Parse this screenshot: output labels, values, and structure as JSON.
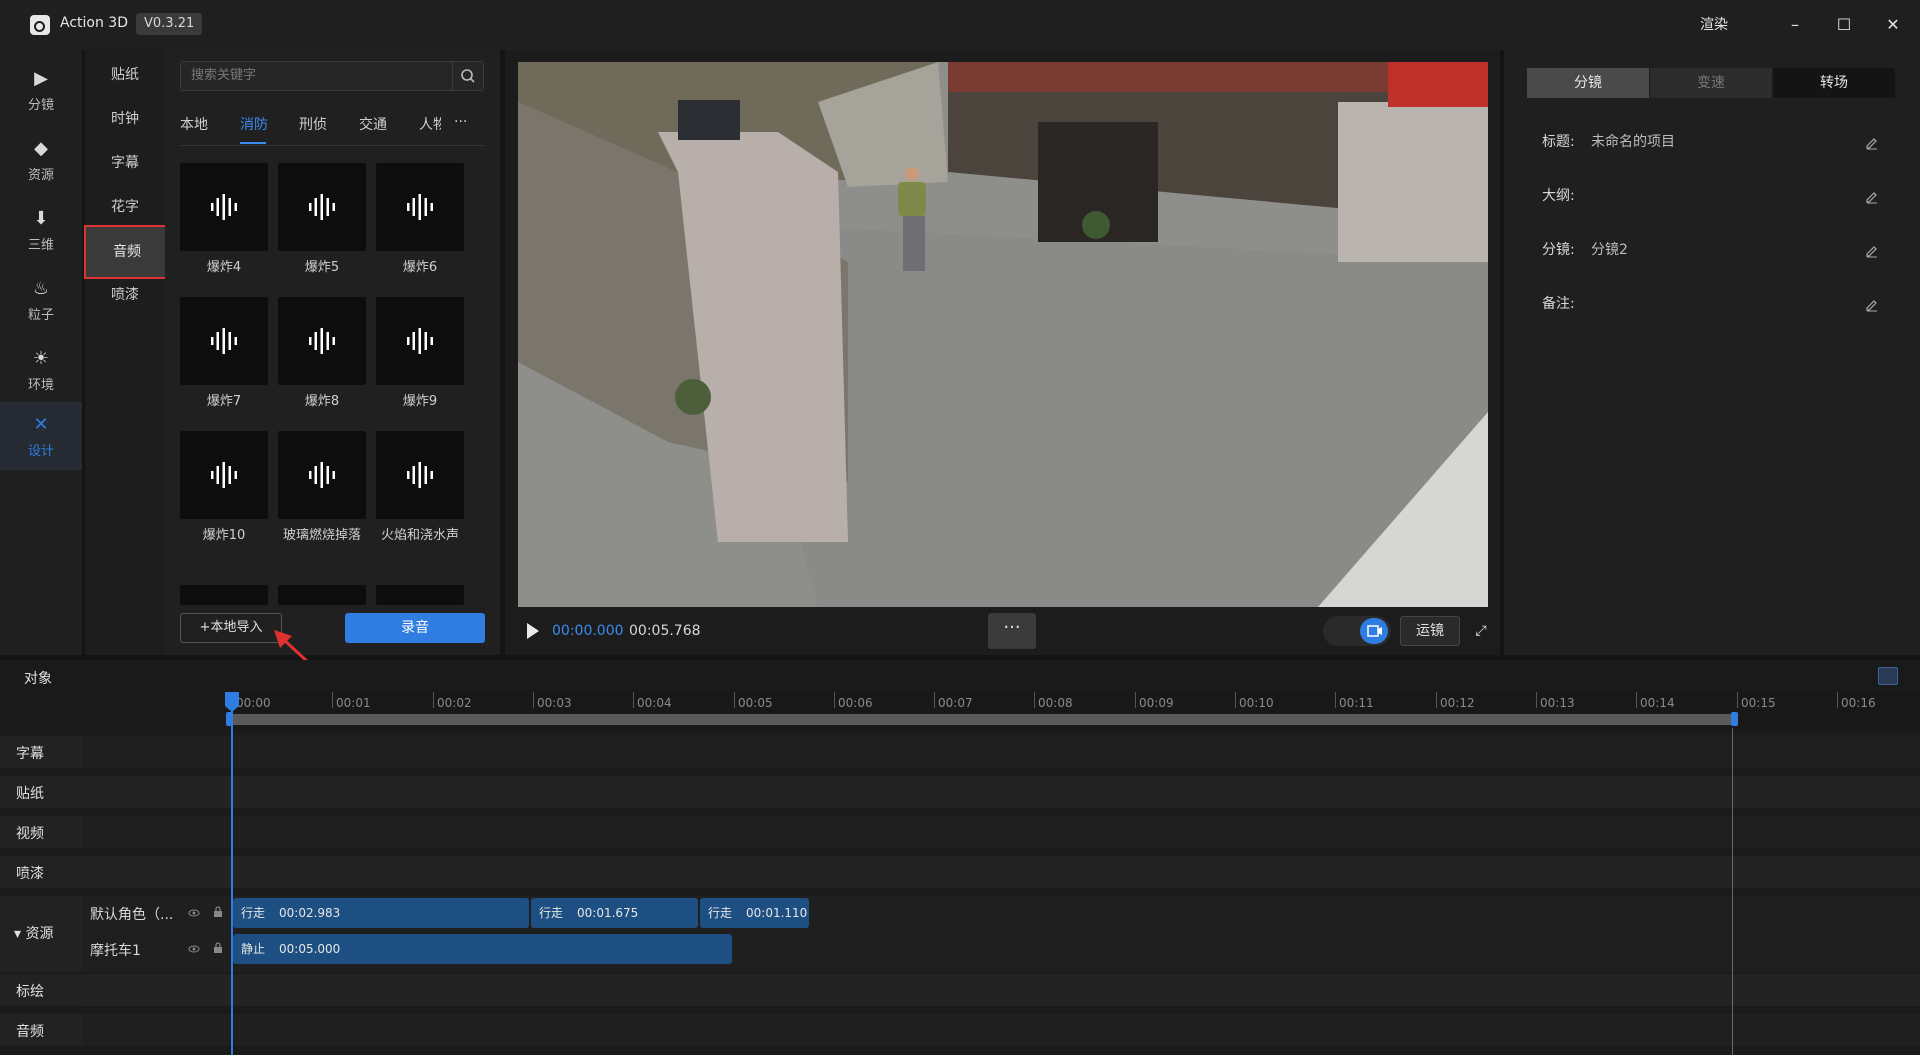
{
  "titlebar": {
    "app_name": "Action 3D",
    "version": "V0.3.21",
    "render_label": "渲染",
    "minimize": "–",
    "maximize": "☐",
    "close": "✕"
  },
  "rail": [
    {
      "label": "分镜",
      "icon": "film-icon"
    },
    {
      "label": "资源",
      "icon": "cube-icon"
    },
    {
      "label": "三维",
      "icon": "download-box-icon"
    },
    {
      "label": "粒子",
      "icon": "flame-icon"
    },
    {
      "label": "环境",
      "icon": "sun-icon"
    },
    {
      "label": "设计",
      "icon": "tools-icon",
      "active": true
    }
  ],
  "subcategories": [
    {
      "label": "贴纸"
    },
    {
      "label": "时钟"
    },
    {
      "label": "字幕"
    },
    {
      "label": "花字"
    },
    {
      "label": "音频",
      "active": true
    },
    {
      "label": "喷漆"
    }
  ],
  "search": {
    "placeholder": "搜索关键字"
  },
  "tabs": [
    {
      "label": "本地"
    },
    {
      "label": "消防",
      "active": true
    },
    {
      "label": "刑侦"
    },
    {
      "label": "交通"
    },
    {
      "label": "人物"
    },
    {
      "label": "···"
    }
  ],
  "audio_items": [
    {
      "label": "爆炸4"
    },
    {
      "label": "爆炸5"
    },
    {
      "label": "爆炸6"
    },
    {
      "label": "爆炸7"
    },
    {
      "label": "爆炸8"
    },
    {
      "label": "爆炸9"
    },
    {
      "label": "爆炸10"
    },
    {
      "label": "玻璃燃烧掉落"
    },
    {
      "label": "火焰和浇水声"
    }
  ],
  "buttons": {
    "import": "+本地导入",
    "record": "录音",
    "more": "···",
    "camera_move": "运镜"
  },
  "player": {
    "current_time": "00:00.000",
    "total_time": "00:05.768"
  },
  "right_tabs": [
    {
      "label": "分镜",
      "state": "selected"
    },
    {
      "label": "变速",
      "state": "disabled"
    },
    {
      "label": "转场",
      "state": "normal"
    }
  ],
  "properties": [
    {
      "label": "标题:",
      "value": "未命名的项目"
    },
    {
      "label": "大纲:",
      "value": ""
    },
    {
      "label": "分镜:",
      "value": "分镜2"
    },
    {
      "label": "备注:",
      "value": ""
    }
  ],
  "timeline": {
    "title": "对象",
    "ticks": [
      "00:00",
      "00:01",
      "00:02",
      "00:03",
      "00:04",
      "00:05",
      "00:06",
      "00:07",
      "00:08",
      "00:09",
      "00:10",
      "00:11",
      "00:12",
      "00:13",
      "00:14",
      "00:15",
      "00:16"
    ],
    "tracks": [
      "字幕",
      "贴纸",
      "视频",
      "喷漆",
      "资源",
      "标绘",
      "音频"
    ],
    "resource_group_label": "▾ 资源",
    "resources": [
      {
        "name": "默认角色（...",
        "clips": [
          {
            "action": "行走",
            "duration": "00:02.983"
          },
          {
            "action": "行走",
            "duration": "00:01.675"
          },
          {
            "action": "行走",
            "duration": "00:01.110"
          }
        ]
      },
      {
        "name": "摩托车1",
        "clips": [
          {
            "action": "静止",
            "duration": "00:05.000"
          }
        ]
      }
    ]
  },
  "colors": {
    "accent": "#2f7de1",
    "highlight_box": "#dd3333",
    "clip": "#1d4f82"
  }
}
